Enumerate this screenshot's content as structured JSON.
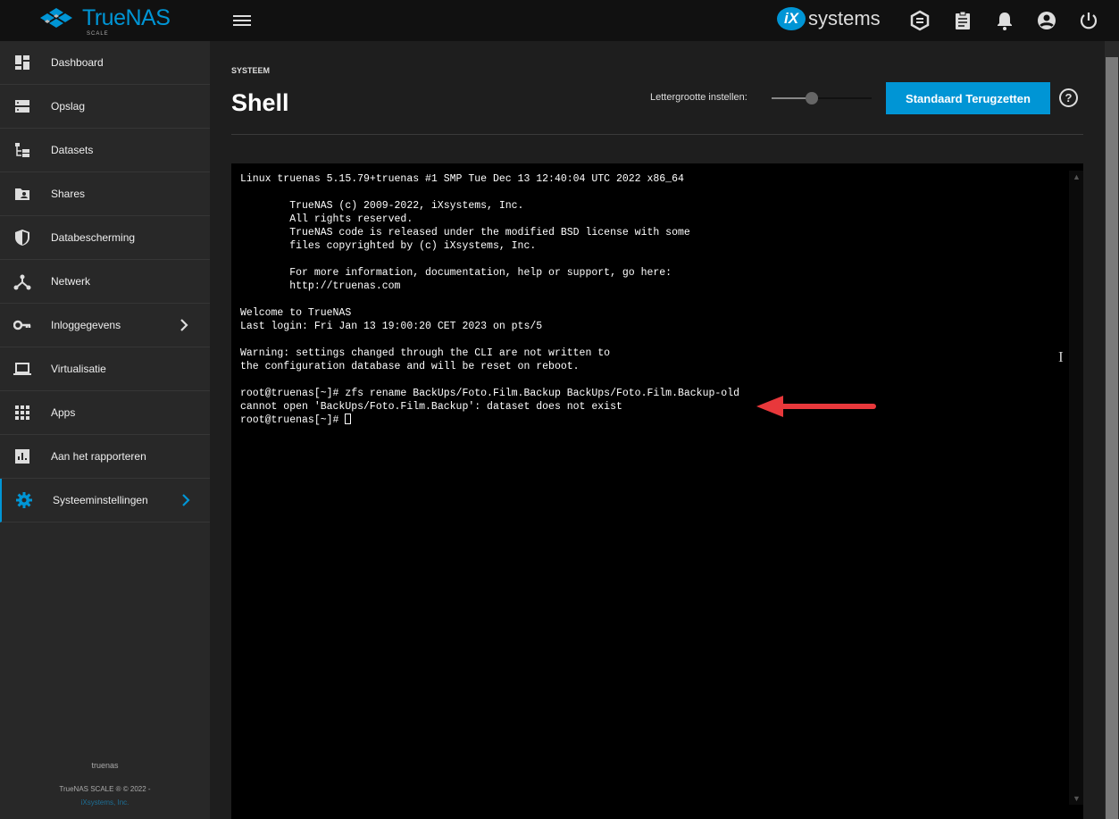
{
  "topbar": {
    "brand": "TrueNAS",
    "brand_sub": "SCALE",
    "partner_logo": "iXsystems",
    "partner_logo_mark": "iX",
    "partner_logo_text": "systems",
    "icons": [
      "truecommand-icon",
      "tasks-icon",
      "bell-icon",
      "account-icon",
      "power-icon"
    ]
  },
  "sidebar": {
    "items": [
      {
        "label": "Dashboard",
        "icon": "dashboard-icon"
      },
      {
        "label": "Opslag",
        "icon": "storage-icon"
      },
      {
        "label": "Datasets",
        "icon": "datasets-icon"
      },
      {
        "label": "Shares",
        "icon": "shares-icon"
      },
      {
        "label": "Databescherming",
        "icon": "shield-icon"
      },
      {
        "label": "Netwerk",
        "icon": "network-icon"
      },
      {
        "label": "Inloggegevens",
        "icon": "key-icon",
        "has_children": true
      },
      {
        "label": "Virtualisatie",
        "icon": "laptop-icon"
      },
      {
        "label": "Apps",
        "icon": "apps-icon"
      },
      {
        "label": "Aan het rapporteren",
        "icon": "reporting-icon"
      },
      {
        "label": "Systeeminstellingen",
        "icon": "gear-icon",
        "has_children": true,
        "active": true
      }
    ],
    "hostname": "truenas",
    "copyright": "TrueNAS SCALE ® © 2022 -",
    "company_link": "iXsystems, Inc."
  },
  "page": {
    "breadcrumb": "SYSTEEM",
    "title": "Shell",
    "font_size_label": "Lettergrootte instellen:",
    "font_size_slider_percent": 40,
    "reset_button": "Standaard Terugzetten",
    "help": "?"
  },
  "terminal": {
    "lines": [
      "Linux truenas 5.15.79+truenas #1 SMP Tue Dec 13 12:40:04 UTC 2022 x86_64",
      "",
      "        TrueNAS (c) 2009-2022, iXsystems, Inc.",
      "        All rights reserved.",
      "        TrueNAS code is released under the modified BSD license with some",
      "        files copyrighted by (c) iXsystems, Inc.",
      "",
      "        For more information, documentation, help or support, go here:",
      "        http://truenas.com",
      "",
      "Welcome to TrueNAS",
      "Last login: Fri Jan 13 19:00:20 CET 2023 on pts/5",
      "",
      "Warning: settings changed through the CLI are not written to",
      "the configuration database and will be reset on reboot.",
      "",
      "root@truenas[~]# zfs rename BackUps/Foto.Film.Backup BackUps/Foto.Film.Backup-old",
      "cannot open 'BackUps/Foto.Film.Backup': dataset does not exist"
    ],
    "prompt": "root@truenas[~]# ",
    "annotation_color": "#e8383b"
  }
}
